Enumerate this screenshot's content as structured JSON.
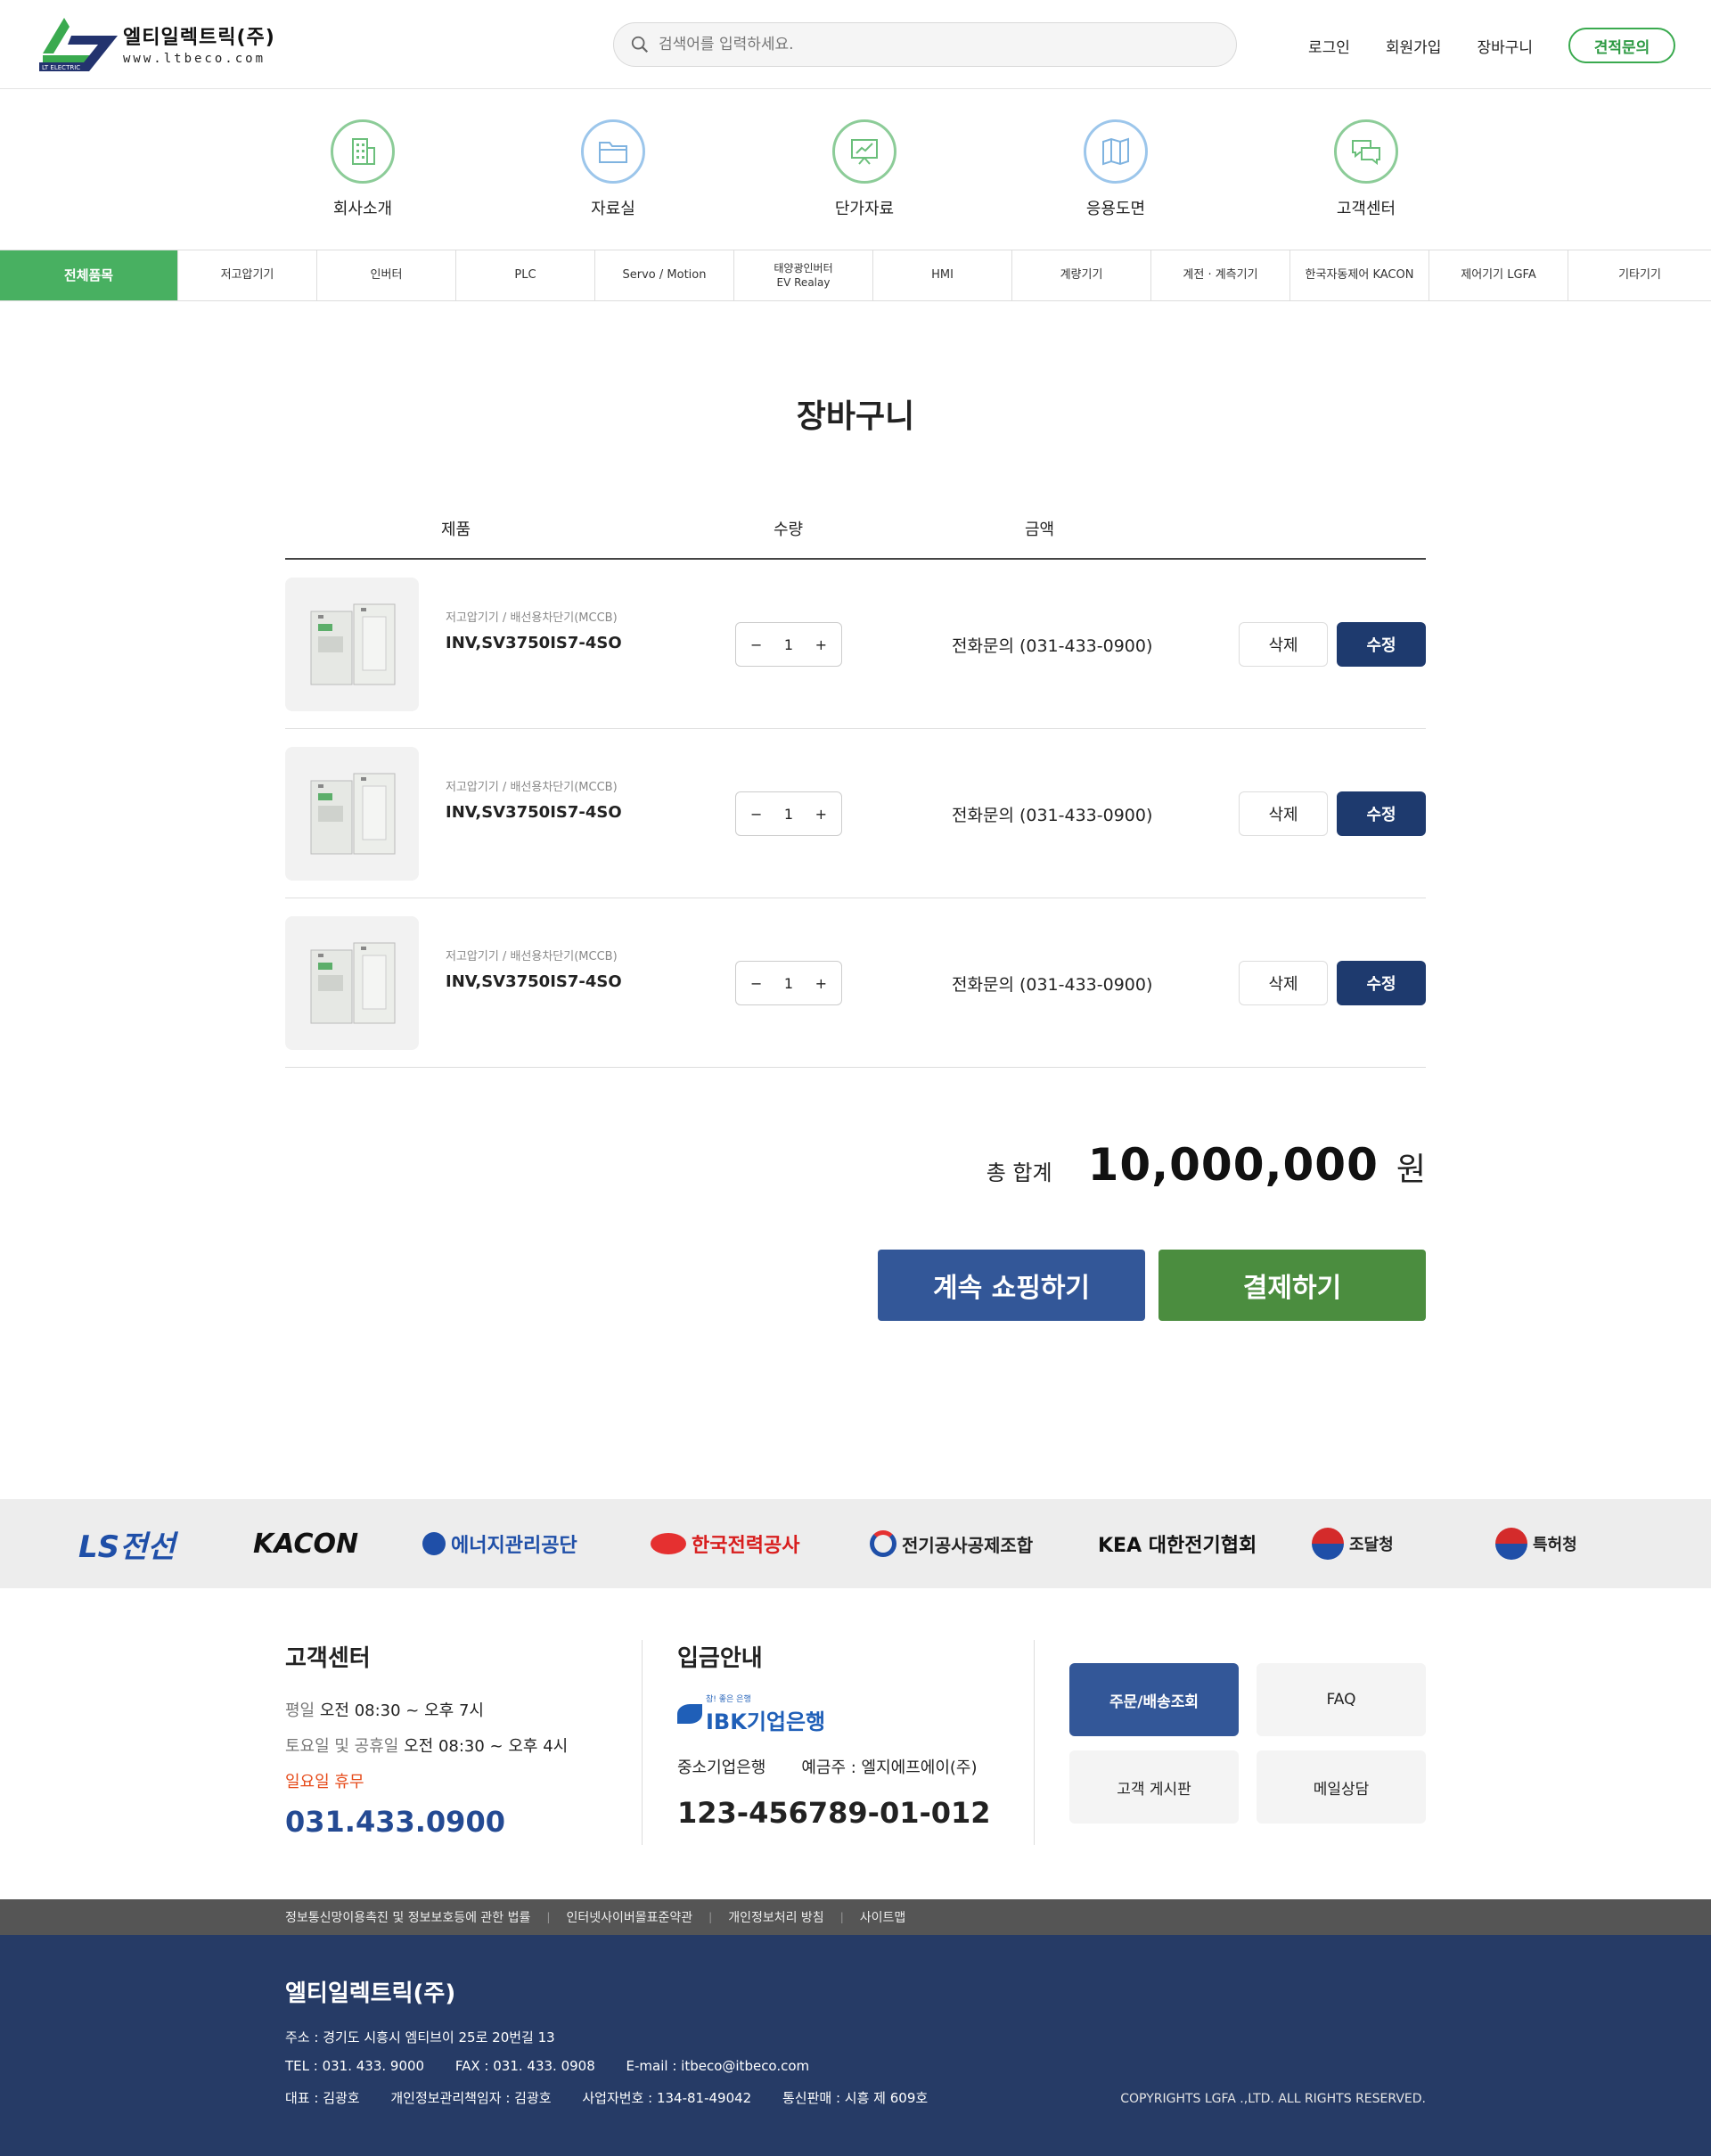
{
  "header": {
    "company_name": "엘티일렉트릭(주)",
    "url": "www.ltbeco.com",
    "logo_badge": "LT ELECTRIC",
    "search_placeholder": "검색어를 입력하세요.",
    "nav": {
      "login": "로그인",
      "signup": "회원가입",
      "cart": "장바구니",
      "quote": "견적문의"
    }
  },
  "icon_nav": [
    {
      "label": "회사소개",
      "icon": "building-icon",
      "color": "#6bbf7b"
    },
    {
      "label": "자료실",
      "icon": "folder-icon",
      "color": "#7fb3e0"
    },
    {
      "label": "단가자료",
      "icon": "presentation-chart-icon",
      "color": "#6bbf7b"
    },
    {
      "label": "응용도면",
      "icon": "map-icon",
      "color": "#7fb3e0"
    },
    {
      "label": "고객센터",
      "icon": "chat-icon",
      "color": "#6bbf7b"
    }
  ],
  "categories": [
    {
      "label": "전체품목"
    },
    {
      "label": "저고압기기"
    },
    {
      "label": "인버터"
    },
    {
      "label": "PLC"
    },
    {
      "label": "Servo / Motion"
    },
    {
      "label": "태양광인버터\nEV Realay"
    },
    {
      "label": "HMI"
    },
    {
      "label": "계량기기"
    },
    {
      "label": "계전 · 계측기기"
    },
    {
      "label": "한국자동제어 KACON"
    },
    {
      "label": "제어기기 LGFA"
    },
    {
      "label": "기타기기"
    }
  ],
  "cart": {
    "title": "장바구니",
    "columns": {
      "product": "제품",
      "qty": "수량",
      "price": "금액"
    },
    "items": [
      {
        "category": "저고압기기 / 배선용차단기(MCCB)",
        "name": "INV,SV3750IS7-4SO",
        "qty": "1",
        "price": "전화문의 (031-433-0900)",
        "delete": "삭제",
        "edit": "수정"
      },
      {
        "category": "저고압기기 / 배선용차단기(MCCB)",
        "name": "INV,SV3750IS7-4SO",
        "qty": "1",
        "price": "전화문의 (031-433-0900)",
        "delete": "삭제",
        "edit": "수정"
      },
      {
        "category": "저고압기기 / 배선용차단기(MCCB)",
        "name": "INV,SV3750IS7-4SO",
        "qty": "1",
        "price": "전화문의 (031-433-0900)",
        "delete": "삭제",
        "edit": "수정"
      }
    ],
    "minus": "−",
    "plus": "+",
    "total_label": "총 합계",
    "total_value": "10,000,000",
    "total_unit": "원",
    "continue_btn": "계속 쇼핑하기",
    "pay_btn": "결제하기"
  },
  "partners": [
    {
      "name": "LS전선"
    },
    {
      "name": "KACON"
    },
    {
      "name": "에너지관리공단"
    },
    {
      "name": "한국전력공사"
    },
    {
      "name": "전기공사공제조합"
    },
    {
      "name": "KEA 대한전기협회"
    },
    {
      "name": "조달청"
    },
    {
      "name": "특허청"
    }
  ],
  "footer": {
    "cs_title": "고객센터",
    "weekday_label": "평일",
    "weekday_hours": "오전 08:30 ~ 오후 7시",
    "sat_label": "토요일 및 공휴일",
    "sat_hours": "오전 08:30 ~ 오후 4시",
    "sunday": "일요일 휴무",
    "phone": "031.433.0900",
    "bank_title": "입금안내",
    "bank_logo_small": "참! 좋은 은행",
    "bank_logo": "IBK기업은행",
    "bank_name": "중소기업은행",
    "depositor": "예금주 : 엘지에프에이(주)",
    "account": "123-456789-01-012",
    "buttons": {
      "order": "주문/배송조회",
      "faq": "FAQ",
      "board": "고객 게시판",
      "mail": "메일상담"
    },
    "links": [
      "정보통신망이용촉진 및 정보보호등에 관한 법률",
      "인터넷사이버몰표준약관",
      "개인정보처리 방침",
      "사이트맵"
    ],
    "company": "엘티일렉트릭(주)",
    "address": "주소 : 경기도 시흥시 엠티브이 25로 20번길 13",
    "tel": "TEL : 031. 433. 9000",
    "fax": "FAX : 031. 433. 0908",
    "email": "E-mail : itbeco@itbeco.com",
    "ceo": "대표 : 김광호",
    "privacy": "개인정보관리책임자 : 김광호",
    "biz_no": "사업자번호 : 134-81-49042",
    "ecommerce": "통신판매 : 시흥 제 609호",
    "copyright": "COPYRIGHTS LGFA .,LTD. ALL RIGHTS RESERVED."
  },
  "colors": {
    "green": "#48b061",
    "navy": "#1e3a6e",
    "blue": "#335798",
    "pay_green": "#4b8d3f",
    "footer_bg": "#263b66"
  }
}
